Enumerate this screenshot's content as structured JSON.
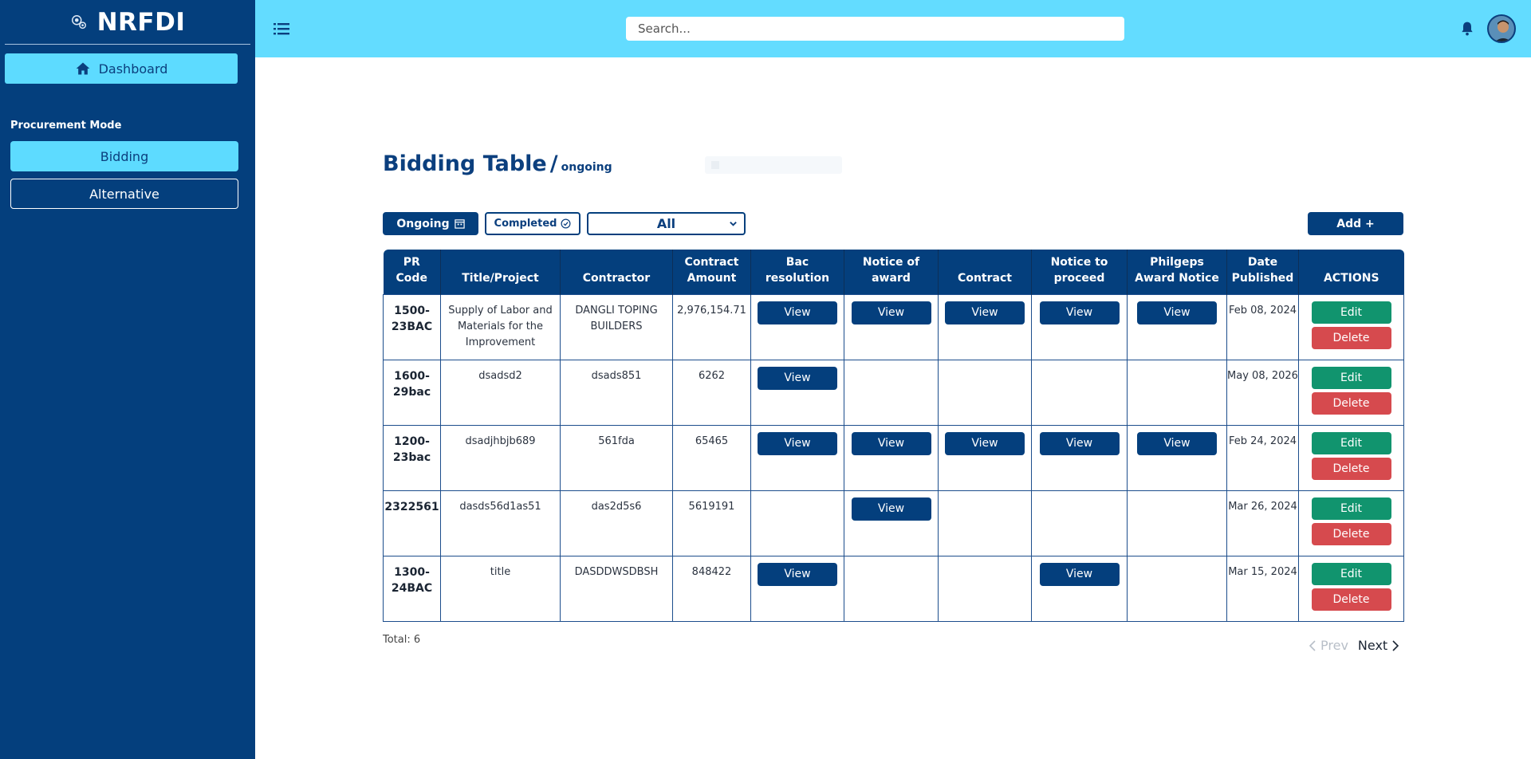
{
  "brand": {
    "name": "NRFDI"
  },
  "sidebar": {
    "dashboard_label": "Dashboard",
    "section_label": "Procurement Mode",
    "modes": [
      "Bidding",
      "Alternative"
    ]
  },
  "topbar": {
    "search_placeholder": "Search..."
  },
  "page": {
    "title": "Bidding Table",
    "separator": "/",
    "subtitle": "ongoing"
  },
  "toolbar": {
    "ongoing_label": "Ongoing",
    "completed_label": "Completed",
    "filter_value": "All",
    "add_label": "Add +"
  },
  "table": {
    "headers": [
      "PR Code",
      "Title/Project",
      "Contractor",
      "Contract Amount",
      "Bac resolution",
      "Notice of award",
      "Contract",
      "Notice to proceed",
      "Philgeps Award Notice",
      "Date Published",
      "ACTIONS"
    ],
    "view_label": "View",
    "edit_label": "Edit",
    "delete_label": "Delete",
    "rows": [
      {
        "pr_code": "1500-23BAC",
        "title": "Supply of Labor and Materials for the Improvement",
        "contractor": "DANGLI TOPING BUILDERS",
        "amount": "2,976,154.71",
        "docs": [
          true,
          true,
          true,
          true,
          true
        ],
        "date": "Feb 08, 2024"
      },
      {
        "pr_code": "1600-29bac",
        "title": "dsadsd2",
        "contractor": "dsads851",
        "amount": "6262",
        "docs": [
          true,
          false,
          false,
          false,
          false
        ],
        "date": "May 08, 2026"
      },
      {
        "pr_code": "1200-23bac",
        "title": "dsadjhbjb689",
        "contractor": "561fda",
        "amount": "65465",
        "docs": [
          true,
          true,
          true,
          true,
          true
        ],
        "date": "Feb 24, 2024"
      },
      {
        "pr_code": "2322561",
        "title": "dasds56d1as51",
        "contractor": "das2d5s6",
        "amount": "5619191",
        "docs": [
          false,
          true,
          false,
          false,
          false
        ],
        "date": "Mar 26, 2024"
      },
      {
        "pr_code": "1300-24BAC",
        "title": "title",
        "contractor": "DASDDWSDBSH",
        "amount": "848422",
        "docs": [
          true,
          false,
          false,
          true,
          false
        ],
        "date": "Mar 15, 2024"
      }
    ]
  },
  "footer": {
    "total": "Total: 6",
    "prev_label": "Prev",
    "next_label": "Next"
  },
  "colors": {
    "sidebar": "#043f7d",
    "topbar": "#63dcff",
    "accent": "#5ddbff",
    "edit": "#11946e",
    "delete": "#d64a4e"
  }
}
